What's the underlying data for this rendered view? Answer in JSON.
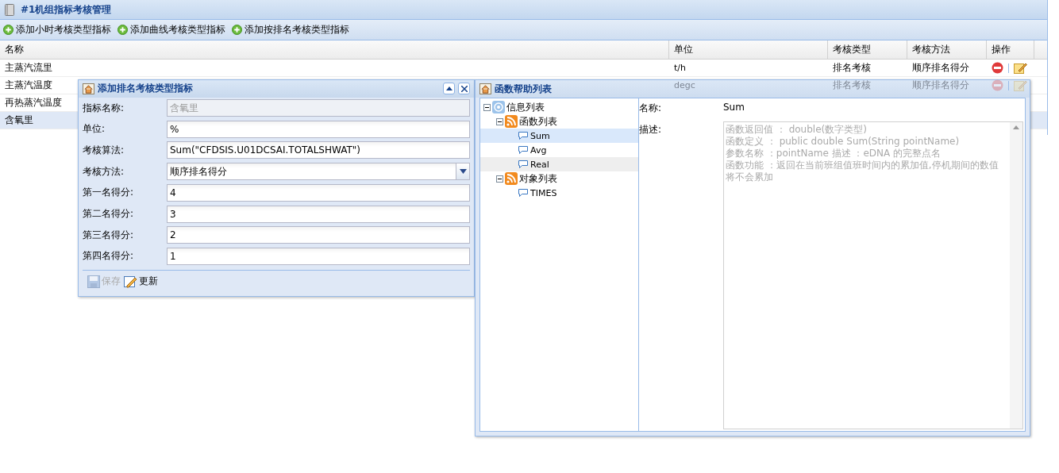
{
  "panel": {
    "title": "#1机组指标考核管理"
  },
  "toolbar": [
    {
      "label": "添加小时考核类型指标"
    },
    {
      "label": "添加曲线考核类型指标"
    },
    {
      "label": "添加按排名考核类型指标"
    }
  ],
  "grid": {
    "columns": [
      "名称",
      "单位",
      "考核类型",
      "考核方法",
      "操作"
    ],
    "rows": [
      {
        "name": "主蒸汽流里",
        "unit": "t/h",
        "type": "排名考核",
        "method": "顺序排名得分",
        "actions": true,
        "selected": false
      },
      {
        "name": "主蒸汽温度",
        "unit": "degc",
        "type": "排名考核",
        "method": "顺序排名得分",
        "actions": true,
        "selected": false
      },
      {
        "name": "再热蒸汽温度",
        "selected": false
      },
      {
        "name": "含氧里",
        "selected": true
      }
    ]
  },
  "form_window": {
    "title": "添加排名考核类型指标",
    "fields": [
      {
        "label": "指标名称:",
        "value": "含氧里",
        "kind": "text",
        "disabled": true
      },
      {
        "label": "单位:",
        "value": "%",
        "kind": "text",
        "disabled": false
      },
      {
        "label": "考核算法:",
        "value": "Sum(\"CFDSIS.U01DCSAI.TOTALSHWAT\")",
        "kind": "text",
        "disabled": false
      },
      {
        "label": "考核方法:",
        "value": "顺序排名得分",
        "kind": "select",
        "disabled": false
      },
      {
        "label": "第一名得分:",
        "value": "4",
        "kind": "text",
        "disabled": false
      },
      {
        "label": "第二名得分:",
        "value": "3",
        "kind": "text",
        "disabled": false
      },
      {
        "label": "第三名得分:",
        "value": "2",
        "kind": "text",
        "disabled": false
      },
      {
        "label": "第四名得分:",
        "value": "1",
        "kind": "text",
        "disabled": false
      }
    ],
    "buttons": [
      {
        "label": "保存",
        "kind": "save",
        "disabled": true
      },
      {
        "label": "更新",
        "kind": "edit",
        "disabled": false
      }
    ]
  },
  "help_window": {
    "title": "函数帮助列表",
    "tree": [
      {
        "label": "信息列表",
        "kind": "root",
        "expanded": true,
        "selected": false,
        "hovered": false,
        "children": [
          {
            "label": "函数列表",
            "kind": "folder",
            "expanded": true,
            "selected": false,
            "hovered": false,
            "children": [
              {
                "label": "Sum",
                "kind": "leaf",
                "selected": true,
                "hovered": false
              },
              {
                "label": "Avg",
                "kind": "leaf",
                "selected": false,
                "hovered": false
              },
              {
                "label": "Real",
                "kind": "leaf",
                "selected": false,
                "hovered": true
              }
            ]
          },
          {
            "label": "对象列表",
            "kind": "folder",
            "expanded": true,
            "selected": false,
            "hovered": false,
            "children": [
              {
                "label": "TIMES",
                "kind": "leaf",
                "selected": false,
                "hovered": false
              }
            ]
          }
        ]
      }
    ],
    "name_label": "名称:",
    "name_value": "Sum",
    "desc_label": "描述:",
    "description": [
      "函数返回值 ： double(数字类型)",
      "函数定义 ： public double Sum(String pointName)",
      "参数名称 ：pointName 描述 ：eDNA 的完整点名",
      "函数功能 ：返回在当前班组值班时间内的累加值,停机期间的数值将不会累加"
    ]
  }
}
